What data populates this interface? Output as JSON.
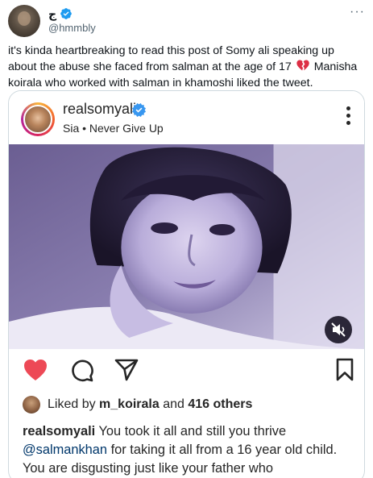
{
  "tweet": {
    "display_name": "ج",
    "handle": "@hmmbly",
    "more_icon": "more-horizontal-icon",
    "text_part1": "it's kinda heartbreaking to read this post of Somy ali speaking up about the abuse she faced from salman at the age of 17",
    "text_emoji": "broken-heart-icon",
    "text_part2": "Manisha koirala who worked with salman in khamoshi liked the tweet.",
    "verified_color": "#1d9bf0"
  },
  "instagram_post": {
    "username": "realsomyali",
    "subtitle": "Sia • Never Give Up",
    "verified_color": "#3897f0",
    "icons": [
      "more-vertical-icon",
      "mute-icon",
      "heart-filled-icon",
      "comment-icon",
      "share-icon",
      "bookmark-icon"
    ],
    "like_color": "#ed4956",
    "liked_by_prefix": "Liked by",
    "liked_by_user": "m_koirala",
    "liked_by_and": "and",
    "liked_by_count": "416 others",
    "caption_user": "realsomyali",
    "caption_part1": "You took it all and still you thrive",
    "caption_mention": "@salmankhan",
    "caption_part2": "for taking it all from a 16 year old child. You are disgusting just like your father who"
  }
}
